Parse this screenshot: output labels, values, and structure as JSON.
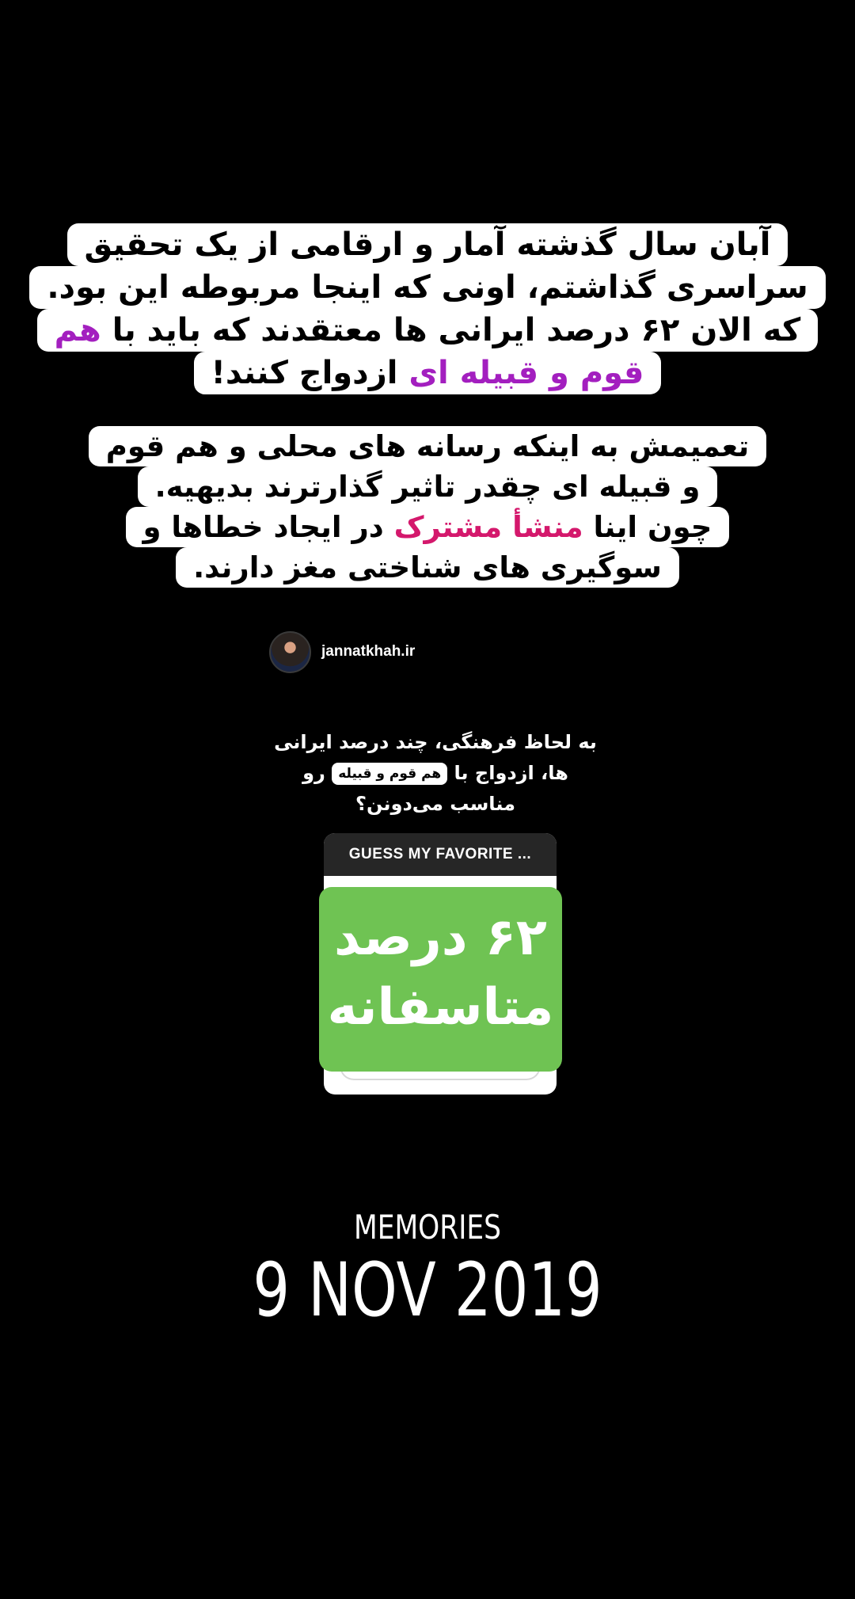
{
  "story_text": {
    "paragraph1": [
      {
        "segments": [
          {
            "text": "آبان سال گذشته آمار و ارقامی از یک تحقیق",
            "style": "normal"
          }
        ]
      },
      {
        "segments": [
          {
            "text": "سراسری گذاشتم، اونی که اینجا مربوطه این بود.",
            "style": "normal"
          }
        ]
      },
      {
        "segments": [
          {
            "text": "که الان ۶۲ درصد ایرانی ها معتقدند که باید با ",
            "style": "normal"
          },
          {
            "text": "هم",
            "style": "purple"
          }
        ]
      },
      {
        "segments": [
          {
            "text": "قوم و قبیله ای",
            "style": "purple"
          },
          {
            "text": " ازدواج کنند!",
            "style": "normal"
          }
        ]
      }
    ],
    "paragraph2": [
      {
        "segments": [
          {
            "text": "تعمیمش به اینکه رسانه های محلی و هم قوم",
            "style": "normal"
          }
        ]
      },
      {
        "segments": [
          {
            "text": "و قبیله ای چقدر تاثیر گذارترند بدیهیه.",
            "style": "normal"
          }
        ]
      },
      {
        "segments": [
          {
            "text": "چون اینا ",
            "style": "normal"
          },
          {
            "text": "منشأ مشترک",
            "style": "pink"
          },
          {
            "text": " در ایجاد خطاها و",
            "style": "normal"
          }
        ]
      },
      {
        "segments": [
          {
            "text": "سوگیری های شناختی مغز دارند.",
            "style": "normal"
          }
        ]
      }
    ]
  },
  "shared_post": {
    "username": "jannatkhah.ir",
    "avatar_icon": "profile-avatar",
    "question_line1": "به لحاظ فرهنگی، چند درصد ایرانی",
    "question_line2_before": "ها، ازدواج با",
    "question_chip": "هم قوم و قبیله",
    "question_line2_after": "رو",
    "question_line3": "مناسب می‌دونن؟"
  },
  "quiz_sticker": {
    "header": "GUESS MY FAVORITE ...",
    "answer_line1": "۶۲ درصد",
    "answer_line2": "متاسفانه"
  },
  "memory": {
    "label": "MEMORIES",
    "date": "9 NOV 2019"
  },
  "colors": {
    "background": "#000000",
    "highlight_purple": "#a31fbf",
    "highlight_pink": "#d4186c",
    "answer_green": "#6fc353"
  }
}
